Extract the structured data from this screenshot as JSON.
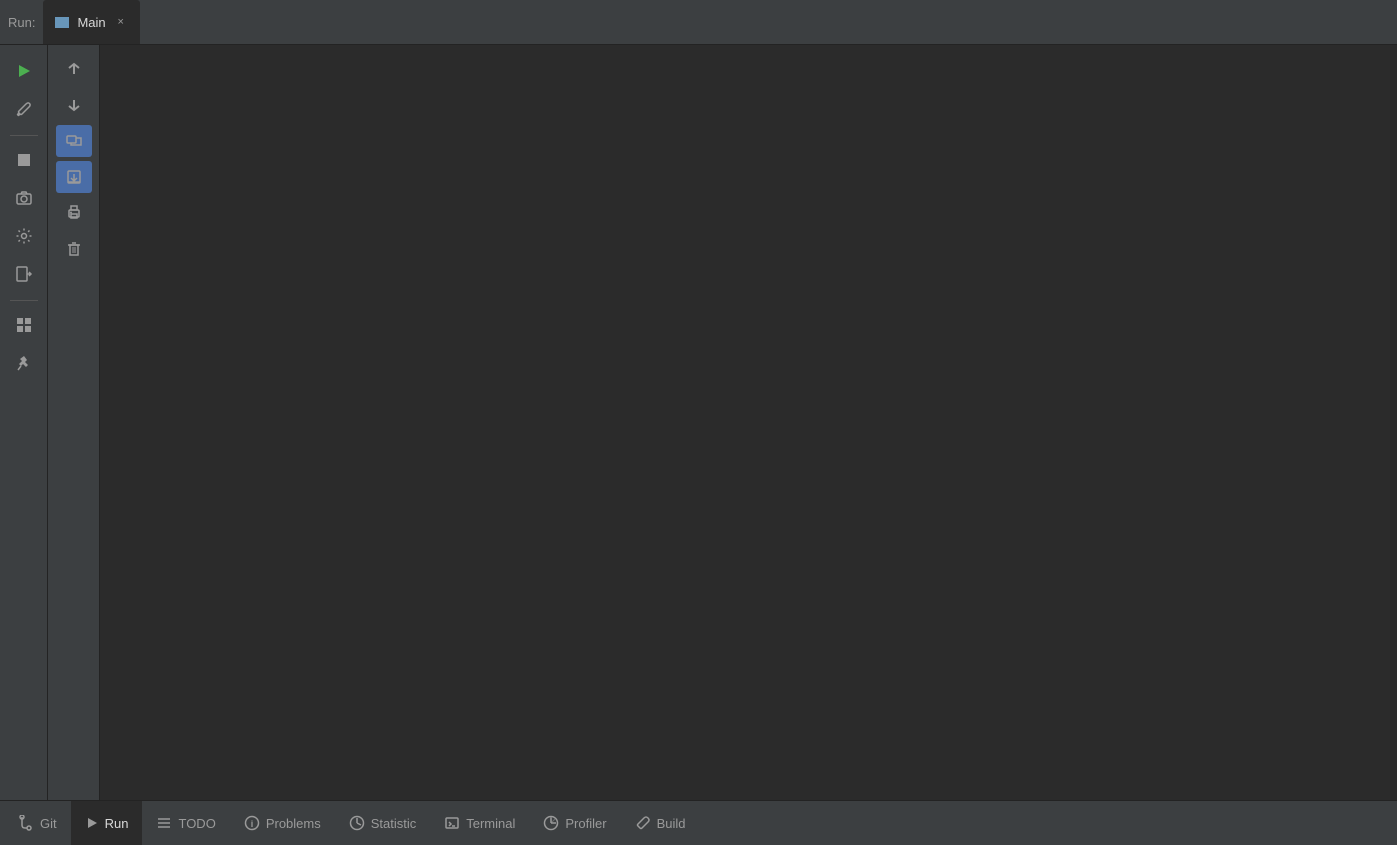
{
  "titleBar": {
    "runLabel": "Run:",
    "tab": {
      "label": "Main",
      "closeSymbol": "×"
    }
  },
  "leftSidebar": {
    "icons": [
      {
        "name": "run-icon",
        "symbol": "▶",
        "interactable": true
      },
      {
        "name": "wrench-icon",
        "symbol": "🔧",
        "interactable": true
      },
      {
        "name": "stop-icon",
        "symbol": "■",
        "interactable": true
      },
      {
        "name": "camera-icon",
        "symbol": "📷",
        "interactable": true
      },
      {
        "name": "settings-icon",
        "symbol": "⚙",
        "interactable": true
      },
      {
        "name": "import-icon",
        "symbol": "⇥",
        "interactable": true
      },
      {
        "name": "panels-icon",
        "symbol": "▦",
        "interactable": true
      },
      {
        "name": "pin-icon",
        "symbol": "📌",
        "interactable": true
      }
    ]
  },
  "secondaryToolbar": {
    "icons": [
      {
        "name": "move-up-icon",
        "symbol": "↑",
        "interactable": true
      },
      {
        "name": "move-down-icon",
        "symbol": "↓",
        "interactable": true
      },
      {
        "name": "rerun-icon",
        "symbol": "⟳",
        "interactable": true,
        "active": true
      },
      {
        "name": "save-to-file-icon",
        "symbol": "⤓",
        "interactable": true,
        "active": true
      },
      {
        "name": "print-icon",
        "symbol": "🖨",
        "interactable": true
      },
      {
        "name": "clear-icon",
        "symbol": "🗑",
        "interactable": true
      }
    ]
  },
  "statusBar": {
    "tabs": [
      {
        "name": "git-tab",
        "icon": "git-icon",
        "iconSymbol": "↪",
        "label": "Git"
      },
      {
        "name": "run-tab",
        "icon": "run-tab-icon",
        "iconSymbol": "▶",
        "label": "Run",
        "active": true
      },
      {
        "name": "todo-tab",
        "icon": "todo-icon",
        "iconSymbol": "≡",
        "label": "TODO"
      },
      {
        "name": "problems-tab",
        "icon": "problems-icon",
        "iconSymbol": "ℹ",
        "label": "Problems"
      },
      {
        "name": "statistic-tab",
        "icon": "statistic-icon",
        "iconSymbol": "◷",
        "label": "Statistic"
      },
      {
        "name": "terminal-tab",
        "icon": "terminal-icon",
        "iconSymbol": "▣",
        "label": "Terminal"
      },
      {
        "name": "profiler-tab",
        "icon": "profiler-icon",
        "iconSymbol": "◔",
        "label": "Profiler"
      },
      {
        "name": "build-tab",
        "icon": "build-icon",
        "iconSymbol": "🔧",
        "label": "Build"
      }
    ]
  }
}
